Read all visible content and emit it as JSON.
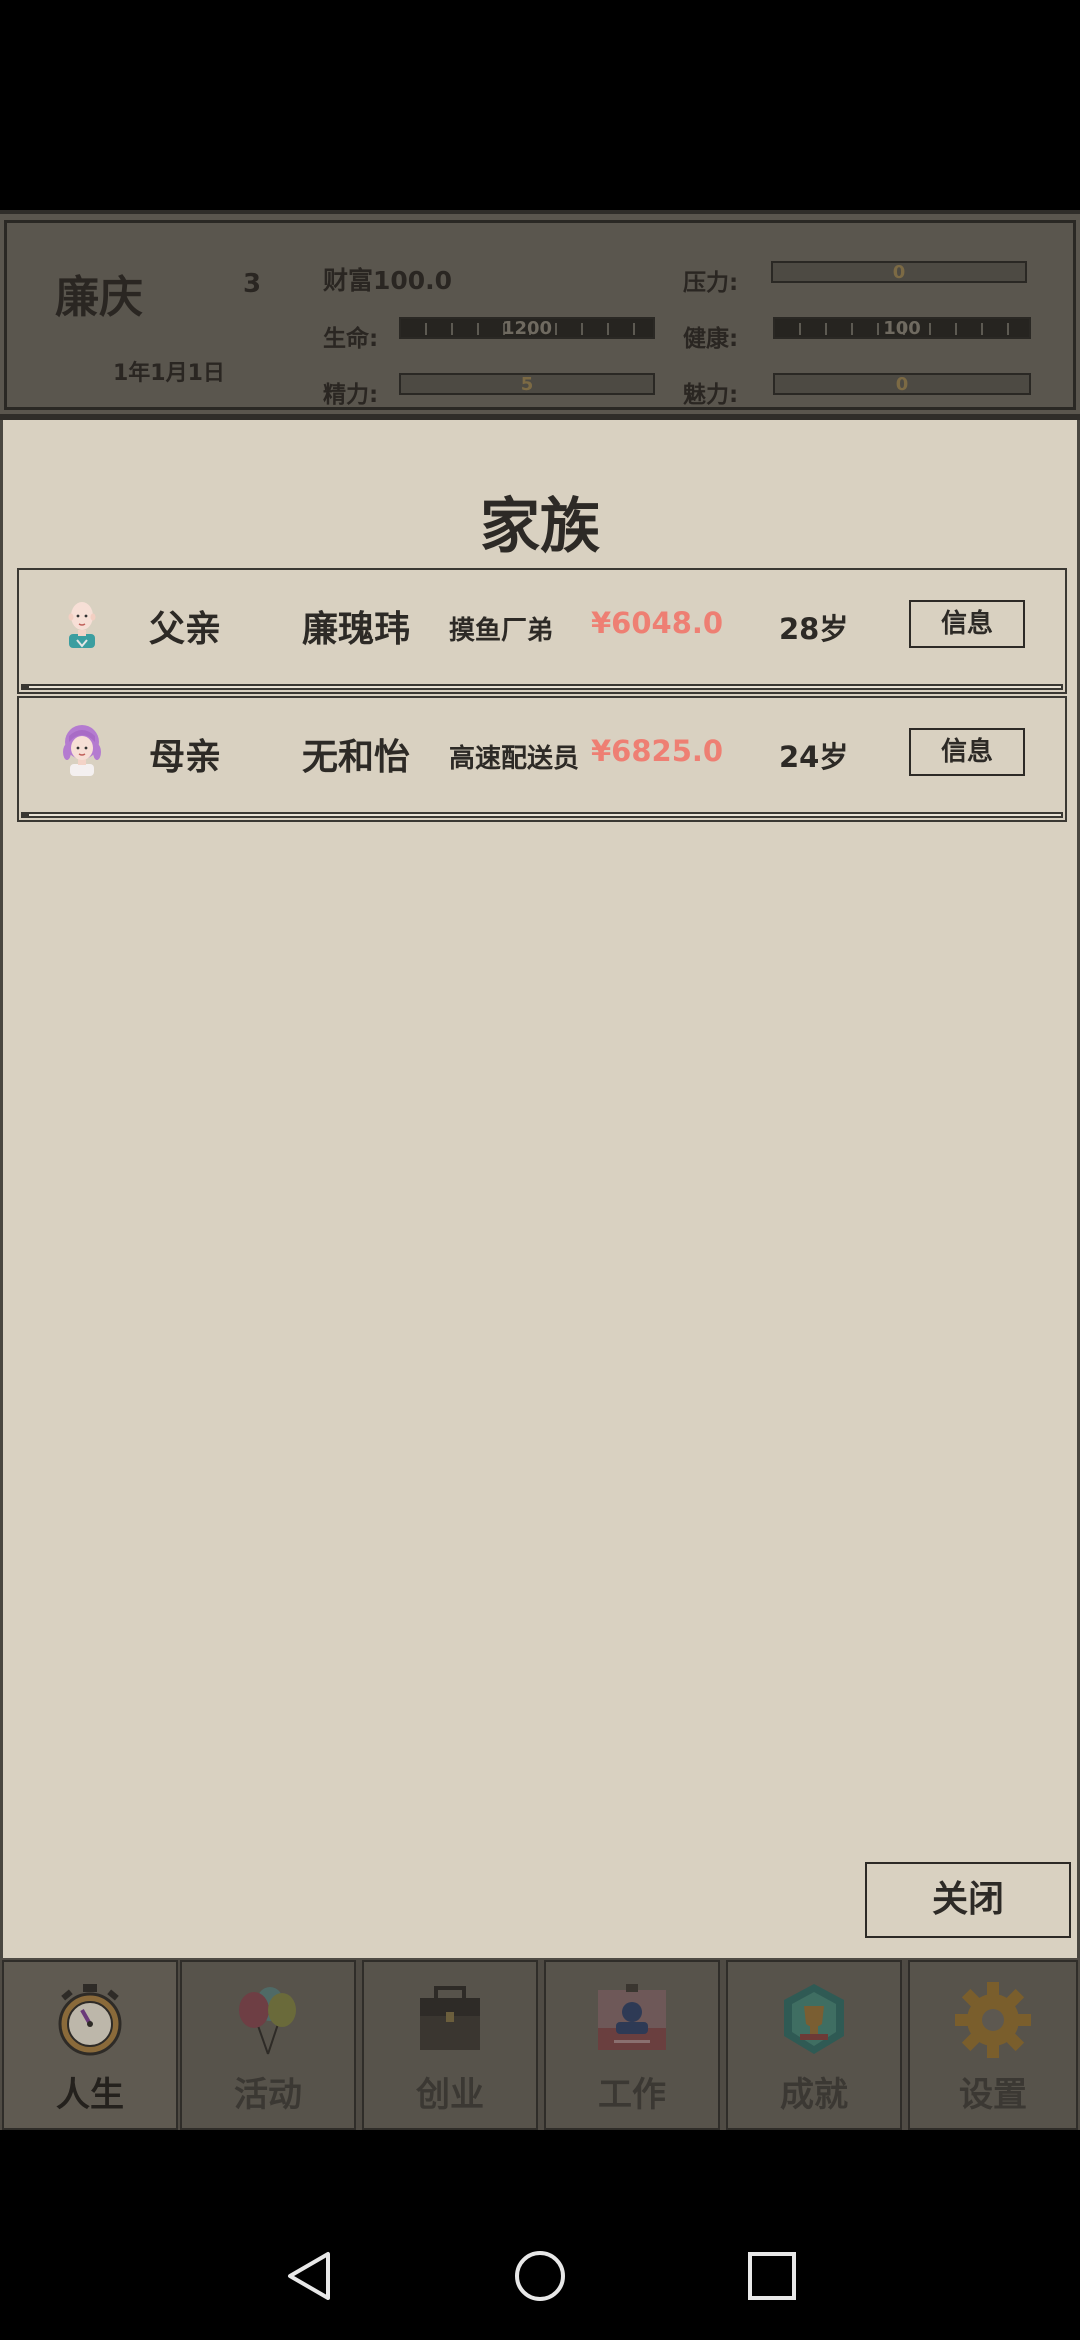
{
  "player": {
    "name": "廉庆",
    "level": "3",
    "date": "1年1月1日",
    "wealth": "财富100.0"
  },
  "stats": {
    "life_label": "生命:",
    "life_value": "1200",
    "energy_label": "精力:",
    "energy_value": "5",
    "stress_label": "压力:",
    "stress_value": "0",
    "health_label": "健康:",
    "health_value": "100",
    "charm_label": "魅力:",
    "charm_value": "0"
  },
  "panel": {
    "title": "家族",
    "close_label": "关闭"
  },
  "family": [
    {
      "relation": "父亲",
      "name": "廉瑰玮",
      "job": "摸鱼厂弟",
      "money": "¥6048.0",
      "age": "28岁",
      "info_label": "信息",
      "avatar": "bald-man-avatar"
    },
    {
      "relation": "母亲",
      "name": "无和怡",
      "job": "高速配送员",
      "money": "¥6825.0",
      "age": "24岁",
      "info_label": "信息",
      "avatar": "purple-hair-woman-avatar"
    }
  ],
  "tabs": [
    {
      "label": "人生",
      "icon": "stopwatch-icon",
      "active": true
    },
    {
      "label": "活动",
      "icon": "balloons-icon"
    },
    {
      "label": "创业",
      "icon": "briefcase-icon"
    },
    {
      "label": "工作",
      "icon": "id-card-icon"
    },
    {
      "label": "成就",
      "icon": "trophy-badge-icon"
    },
    {
      "label": "设置",
      "icon": "gear-icon"
    }
  ],
  "colors": {
    "panel_bg": "#d9d1c1",
    "money": "#ee7f73",
    "header_bg": "#5a564e"
  }
}
